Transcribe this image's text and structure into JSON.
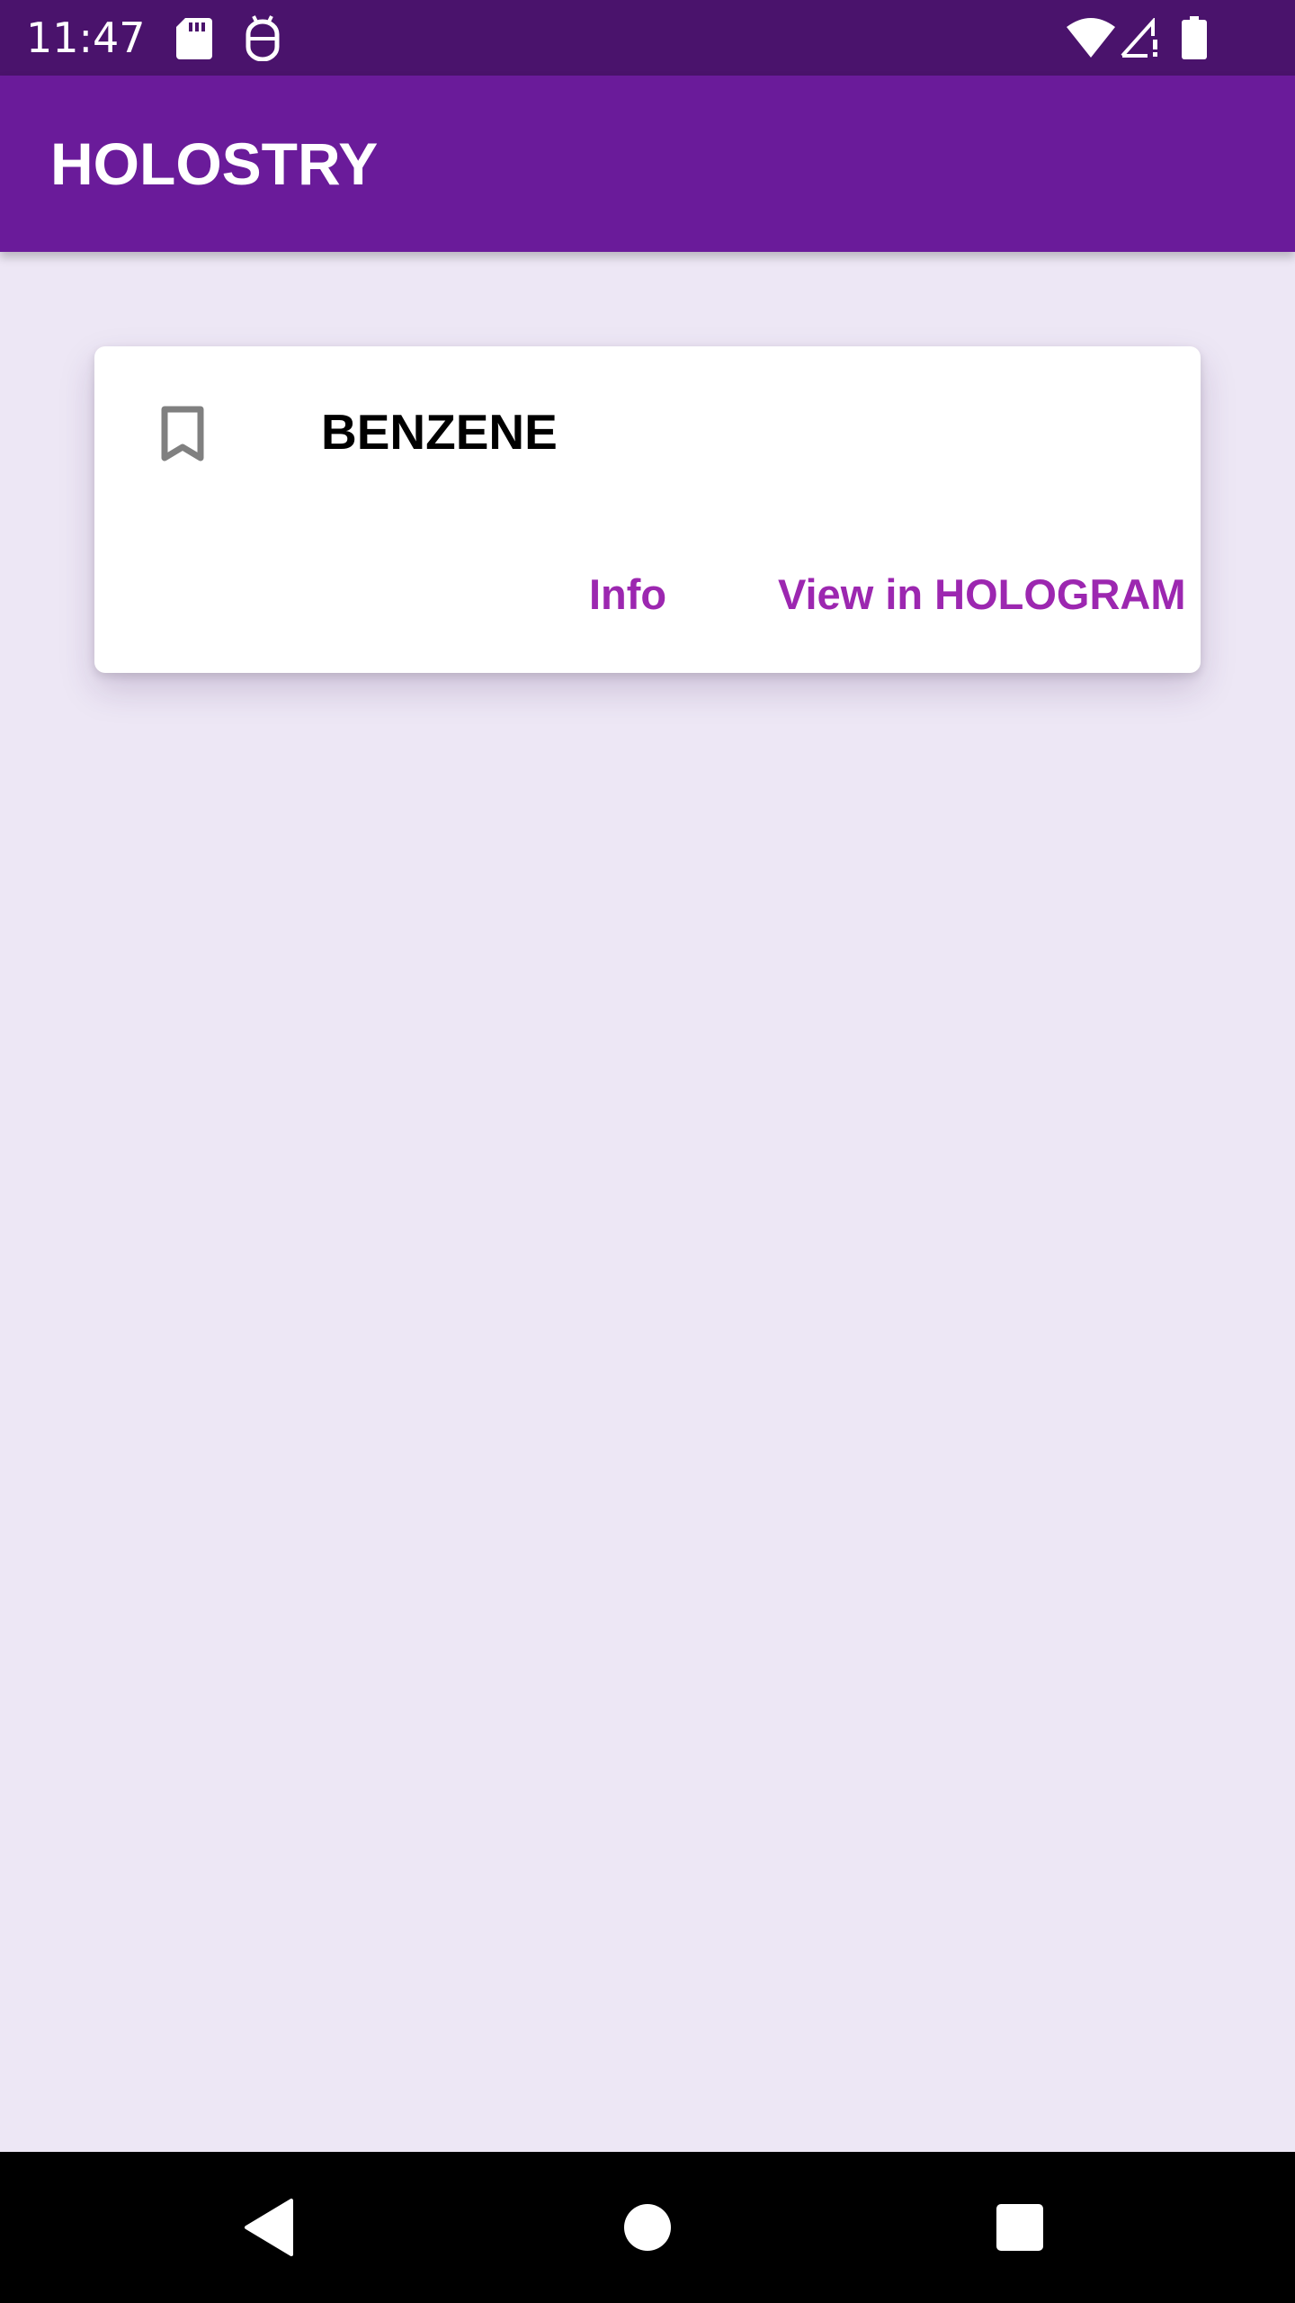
{
  "status_bar": {
    "time": "11:47",
    "icons": [
      "sd-card-icon",
      "android-debug-icon",
      "wifi-icon",
      "signal-icon",
      "battery-icon"
    ]
  },
  "app_bar": {
    "title": "HOLOSTRY"
  },
  "card": {
    "icon": "bookmark-icon",
    "title": "BENZENE",
    "info_button": "Info",
    "hologram_button": "View in HOLOGRAM"
  },
  "nav_bar": {
    "icons": [
      "back-icon",
      "home-icon",
      "recents-icon"
    ]
  },
  "colors": {
    "status_bar": "#4a136c",
    "app_bar": "#6a1b9a",
    "background": "#ede7f5",
    "accent": "#9c27b0",
    "icon_gray": "#808080"
  }
}
